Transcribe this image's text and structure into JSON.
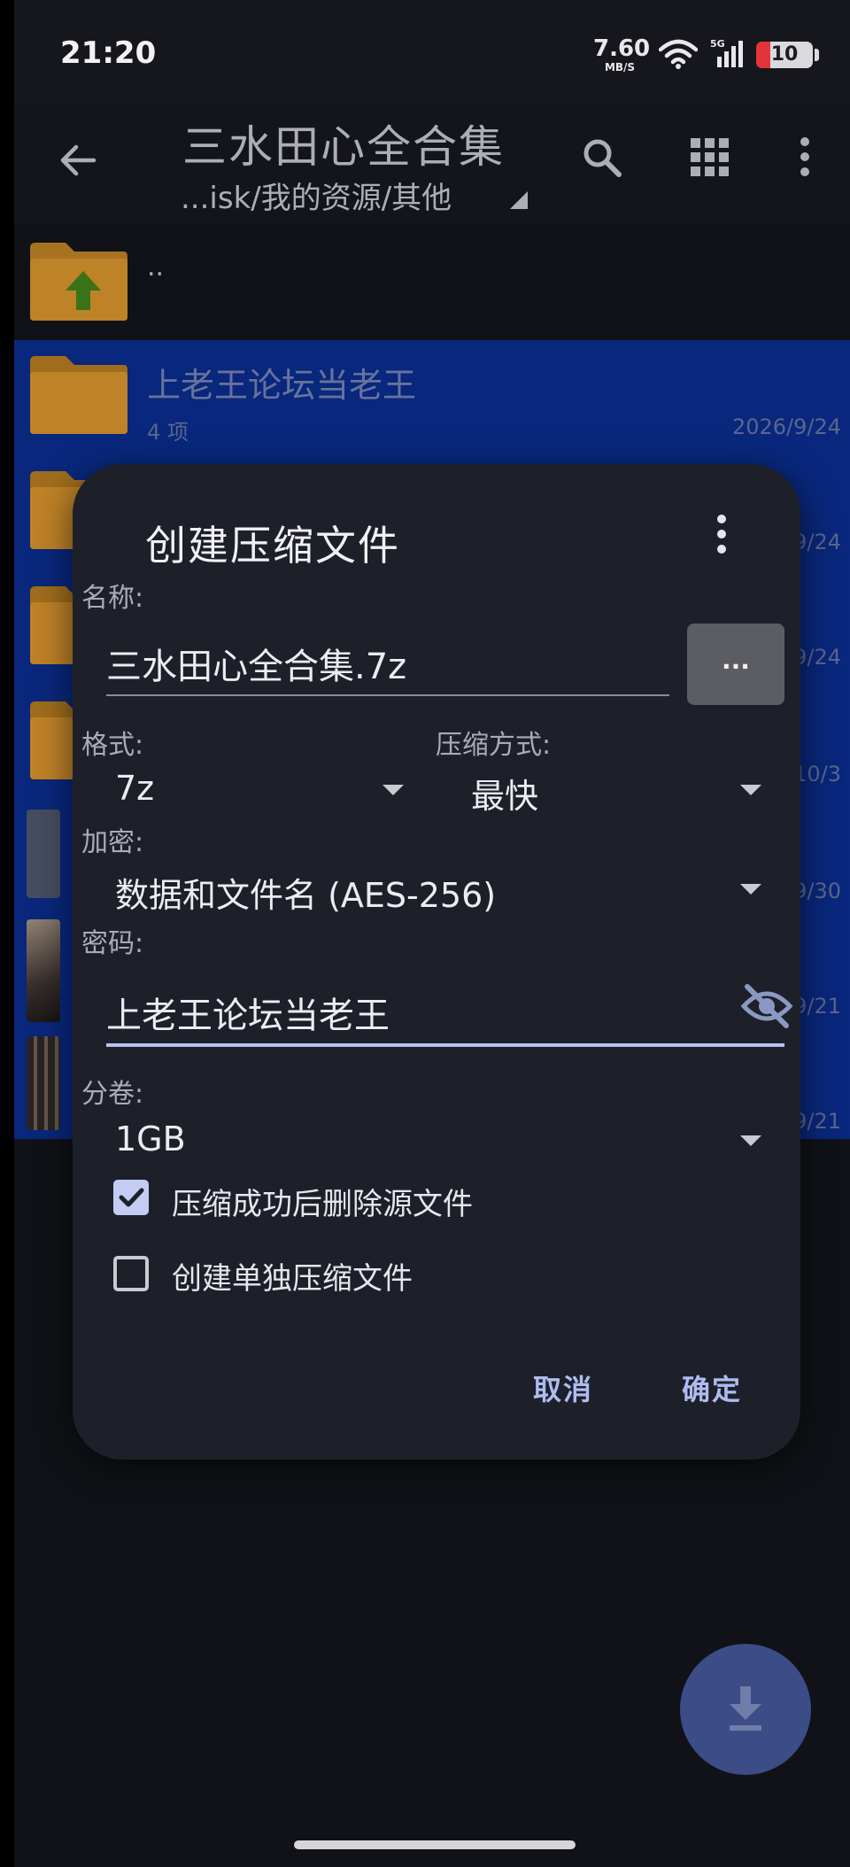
{
  "status_bar": {
    "time": "21:20",
    "net_speed_value": "7.60",
    "net_speed_unit": "MB/S",
    "signal_label": "5G",
    "battery": "10"
  },
  "app_bar": {
    "title": "三水田心全合集",
    "path": "...isk/我的资源/其他"
  },
  "file_list": {
    "parent_label": "..",
    "items": [
      {
        "name": "上老王论坛当老王",
        "meta": "4 项",
        "date": "2026/9/24"
      },
      {
        "date": "9/24"
      },
      {
        "date": "9/24"
      },
      {
        "date": "10/3"
      },
      {
        "date": "9/30"
      },
      {
        "date": "9/21"
      },
      {
        "date": "9/21"
      }
    ]
  },
  "dialog": {
    "title": "创建压缩文件",
    "name_label": "名称:",
    "name_value": "三水田心全合集.7z",
    "browse_label": "...",
    "format_label": "格式:",
    "format_value": "7z",
    "method_label": "压缩方式:",
    "method_value": "最快",
    "encryption_label": "加密:",
    "encryption_value": "数据和文件名 (AES-256)",
    "password_label": "密码:",
    "password_value": "上老王论坛当老王",
    "split_label": "分卷:",
    "split_value": "1GB",
    "delete_source_label": "压缩成功后删除源文件",
    "delete_source_checked": true,
    "separate_archives_label": "创建单独压缩文件",
    "separate_archives_checked": false,
    "cancel_label": "取消",
    "ok_label": "确定"
  },
  "colors": {
    "selected_row": "#0a2a83",
    "dialog_bg": "#1e2029",
    "accent": "#aebcf0",
    "folder": "#c98a2a"
  }
}
